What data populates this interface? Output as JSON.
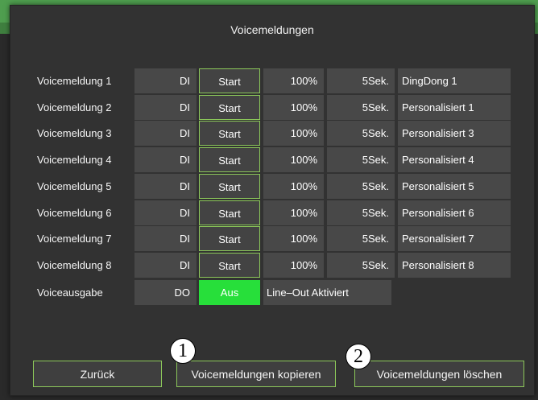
{
  "dialog": {
    "title": "Voicemeldungen"
  },
  "messages": [
    {
      "label": "Voicemeldung 1",
      "type": "DI",
      "action": "Start",
      "volume": "100%",
      "duration": "5Sek.",
      "sound": "DingDong 1"
    },
    {
      "label": "Voicemeldung 2",
      "type": "DI",
      "action": "Start",
      "volume": "100%",
      "duration": "5Sek.",
      "sound": "Personalisiert 1"
    },
    {
      "label": "Voicemeldung 3",
      "type": "DI",
      "action": "Start",
      "volume": "100%",
      "duration": "5Sek.",
      "sound": "Personalisiert 3"
    },
    {
      "label": "Voicemeldung 4",
      "type": "DI",
      "action": "Start",
      "volume": "100%",
      "duration": "5Sek.",
      "sound": "Personalisiert 4"
    },
    {
      "label": "Voicemeldung 5",
      "type": "DI",
      "action": "Start",
      "volume": "100%",
      "duration": "5Sek.",
      "sound": "Personalisiert 5"
    },
    {
      "label": "Voicemeldung 6",
      "type": "DI",
      "action": "Start",
      "volume": "100%",
      "duration": "5Sek.",
      "sound": "Personalisiert 6"
    },
    {
      "label": "Voicemeldung 7",
      "type": "DI",
      "action": "Start",
      "volume": "100%",
      "duration": "5Sek.",
      "sound": "Personalisiert 7"
    },
    {
      "label": "Voicemeldung 8",
      "type": "DI",
      "action": "Start",
      "volume": "100%",
      "duration": "5Sek.",
      "sound": "Personalisiert 8"
    }
  ],
  "voice_output": {
    "label": "Voiceausgabe",
    "type": "DO",
    "state": "Aus",
    "line_out": "Line–Out Aktiviert"
  },
  "buttons": {
    "back": "Zurück",
    "copy": "Voicemeldungen kopieren",
    "delete": "Voicemeldungen löschen"
  },
  "markers": {
    "one": "1",
    "two": "2"
  },
  "colors": {
    "accent": "#8cc85a",
    "active": "#27df3a",
    "panel": "#323232",
    "cell": "#484848"
  }
}
